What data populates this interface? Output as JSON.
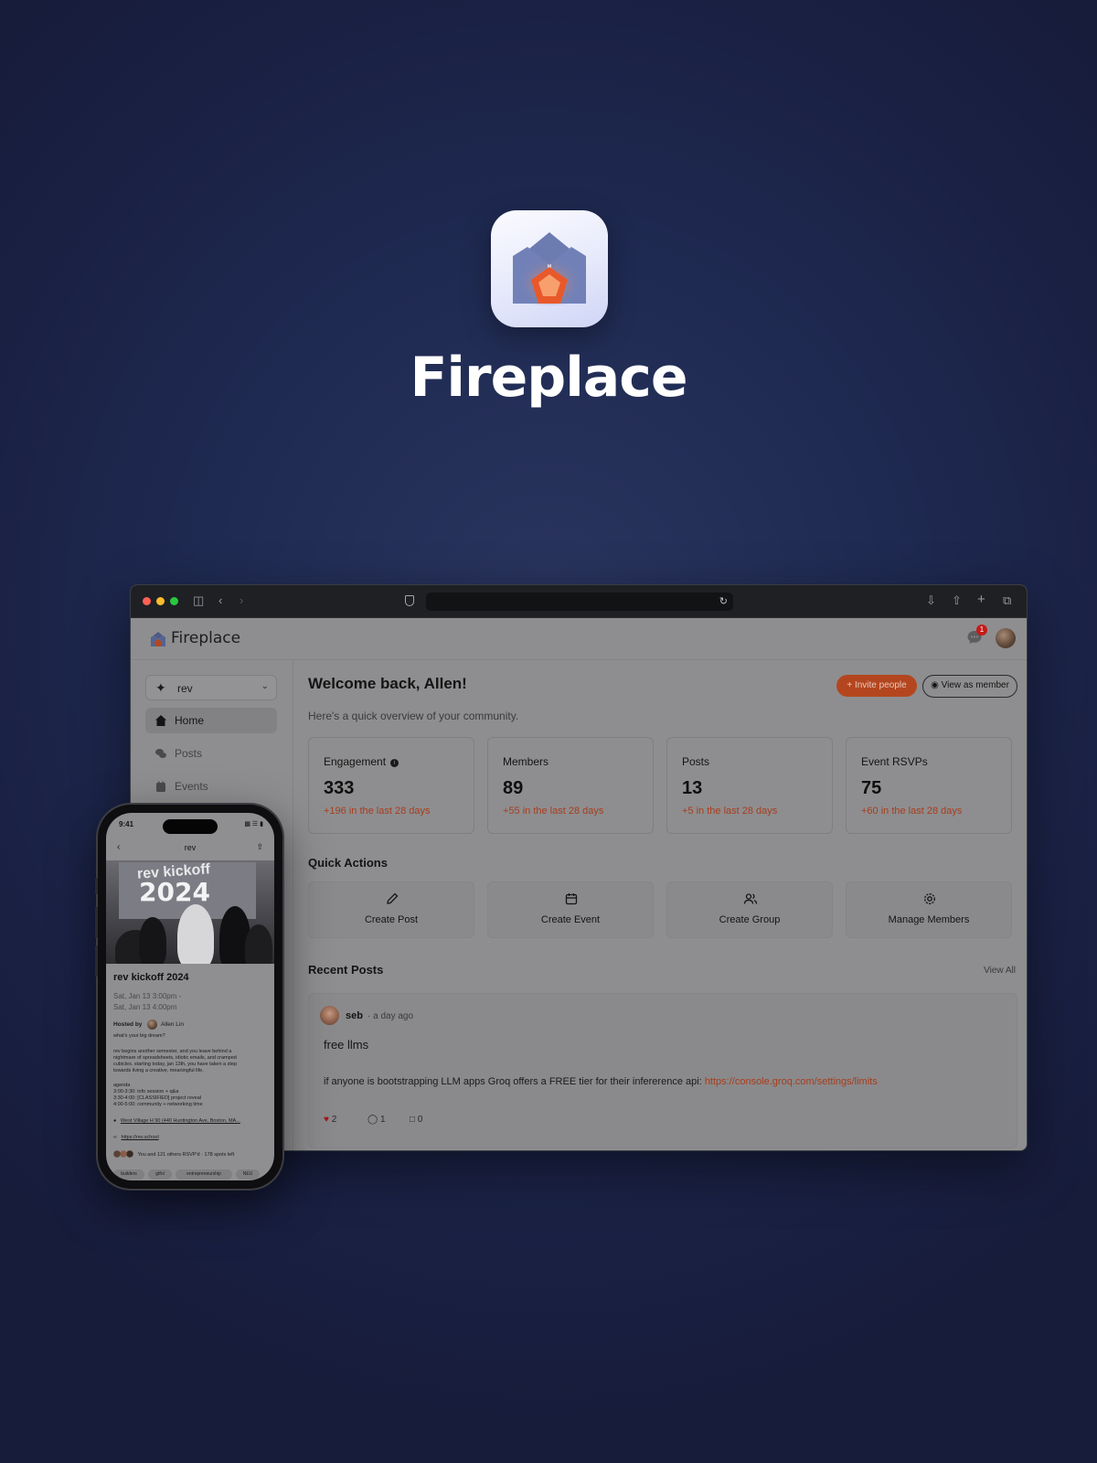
{
  "hero": {
    "app_name": "Fireplace"
  },
  "browser": {
    "app": {
      "brand": "Fireplace",
      "notifications_count": "1",
      "sidebar": {
        "workspace": "rev",
        "items": [
          {
            "label": "Home",
            "icon": "house-icon",
            "active": true
          },
          {
            "label": "Posts",
            "icon": "chat-bubbles-icon",
            "active": false
          },
          {
            "label": "Events",
            "icon": "calendar-icon",
            "active": false
          }
        ]
      },
      "main": {
        "welcome": "Welcome back, Allen!",
        "subtitle": "Here's a quick overview of your community.",
        "invite_label": "Invite people",
        "view_as_member_label": "View as member",
        "stats": [
          {
            "title": "Engagement",
            "value": "333",
            "delta": "+196 in the last 28 days",
            "has_info": true
          },
          {
            "title": "Members",
            "value": "89",
            "delta": "+55 in the last 28 days",
            "has_info": false
          },
          {
            "title": "Posts",
            "value": "13",
            "delta": "+5 in the last 28 days",
            "has_info": false
          },
          {
            "title": "Event RSVPs",
            "value": "75",
            "delta": "+60 in the last 28 days",
            "has_info": false
          }
        ],
        "quick_actions_title": "Quick Actions",
        "quick_actions": [
          {
            "label": "Create Post",
            "icon": "pencil-icon"
          },
          {
            "label": "Create Event",
            "icon": "calendar-icon"
          },
          {
            "label": "Create Group",
            "icon": "users-icon"
          },
          {
            "label": "Manage Members",
            "icon": "gear-icon"
          }
        ],
        "recent_posts_title": "Recent Posts",
        "view_all": "View All",
        "post": {
          "author": "seb",
          "time": "· a day ago",
          "title": "free llms",
          "body": "if anyone is bootstrapping LLM apps Groq offers a FREE tier for their infererence api:",
          "link": "https://console.groq.com/settings/limits",
          "likes": "2",
          "comments": "1",
          "bookmarks": "0"
        }
      }
    }
  },
  "phone": {
    "status_time": "9:41",
    "nav_title": "rev",
    "photo_text_1": "rev kickoff",
    "photo_text_2": "2024",
    "event_title": "rev kickoff 2024",
    "date_start": "Sat, Jan 13 3:00pm -",
    "date_end": "Sat, Jan 13 4:00pm",
    "hosted_by": "Hosted by",
    "host_name": "Allen Lin",
    "lines": [
      "what's your big dream?",
      "",
      "rev begins another semester, and you leave behind a",
      "nightmare of spreadsheets, idiotic emails, and cramped",
      "cubicles. starting today, jan 13th, you have taken a step",
      "towards living a creative, meaningful life.",
      "",
      "agenda",
      "3:00-3:30: info session + q&a",
      "3:30-4:00: [CLASSIFIED] project reveal",
      "4:00-5:00: community + networking time"
    ],
    "location": "West Village H 90 (440 Huntington Ave, Boston, MA...",
    "website": "https://rev.school",
    "rsvp": "You and 121 others RSVP'd · 178 spots left",
    "tags": [
      "builders",
      "gtfol",
      "entrepreneurship",
      "NEU"
    ]
  }
}
